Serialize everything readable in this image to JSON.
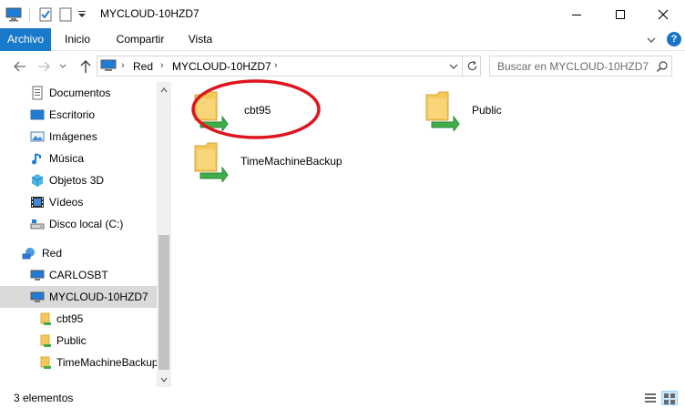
{
  "window": {
    "title": "MYCLOUD-10HZD7"
  },
  "ribbon": {
    "tabs": [
      {
        "label": "Archivo"
      },
      {
        "label": "Inicio"
      },
      {
        "label": "Compartir"
      },
      {
        "label": "Vista"
      }
    ],
    "help_label": "?"
  },
  "address": {
    "crumbs": [
      "Red",
      "MYCLOUD-10HZD7"
    ]
  },
  "search": {
    "placeholder": "Buscar en MYCLOUD-10HZD7"
  },
  "nav": {
    "items": [
      {
        "label": "Documentos",
        "icon": "documents-icon"
      },
      {
        "label": "Escritorio",
        "icon": "desktop-icon"
      },
      {
        "label": "Imágenes",
        "icon": "pictures-icon"
      },
      {
        "label": "Música",
        "icon": "music-icon"
      },
      {
        "label": "Objetos 3D",
        "icon": "3d-objects-icon"
      },
      {
        "label": "Vídeos",
        "icon": "videos-icon"
      },
      {
        "label": "Disco local (C:)",
        "icon": "local-disk-icon"
      },
      {
        "label": "Red",
        "icon": "network-icon"
      },
      {
        "label": "CARLOSBT",
        "icon": "computer-icon"
      },
      {
        "label": "MYCLOUD-10HZD7",
        "icon": "computer-icon"
      },
      {
        "label": "cbt95",
        "icon": "share-folder-icon"
      },
      {
        "label": "Public",
        "icon": "share-folder-icon"
      },
      {
        "label": "TimeMachineBackup",
        "icon": "share-folder-icon"
      }
    ]
  },
  "content": {
    "items": [
      {
        "label": "cbt95",
        "icon": "network-share-icon"
      },
      {
        "label": "Public",
        "icon": "network-share-icon"
      },
      {
        "label": "TimeMachineBackup",
        "icon": "network-share-icon"
      }
    ]
  },
  "status": {
    "count": "3 elementos"
  },
  "colors": {
    "accent": "#1979ca",
    "selection": "#d9d9d9",
    "highlight_circle": "#e0141e",
    "folder": "#f5c75a",
    "share_green": "#3fae49"
  }
}
